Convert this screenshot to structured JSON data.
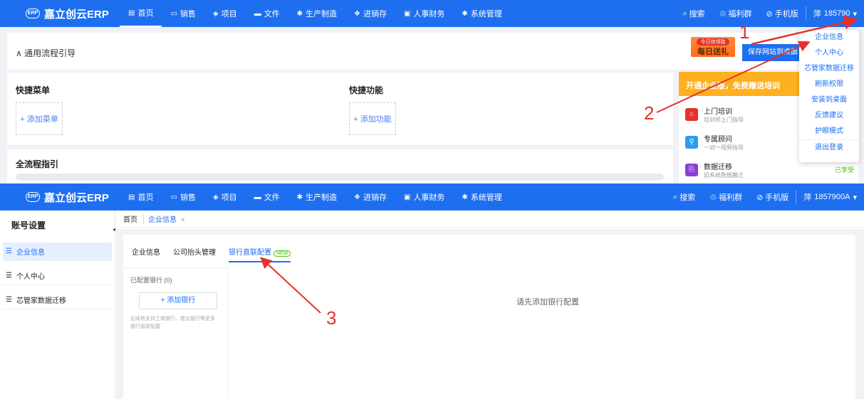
{
  "app": {
    "logo_text": "嘉立创云ERP",
    "logo_mark": "ERP"
  },
  "nav": {
    "items": [
      {
        "icon": "▤",
        "label": "首页"
      },
      {
        "icon": "▭",
        "label": "销售"
      },
      {
        "icon": "◈",
        "label": "项目"
      },
      {
        "icon": "▬",
        "label": "文件"
      },
      {
        "icon": "✱",
        "label": "生产制造"
      },
      {
        "icon": "❖",
        "label": "进销存"
      },
      {
        "icon": "▣",
        "label": "人事财务"
      },
      {
        "icon": "✱",
        "label": "系统管理"
      }
    ]
  },
  "right_tools": {
    "search": "搜索",
    "benefits": "福利群",
    "mobile": "手机版",
    "user_top": "185790",
    "user_bottom": "1857900A",
    "user_icon": "萍"
  },
  "upper": {
    "guide_title": "通用流程引导",
    "quick_menu_title": "快捷菜单",
    "add_menu": "+ 添加菜单",
    "quick_func_title": "快捷功能",
    "add_func": "+ 添加功能",
    "full_guide_title": "全流程指引",
    "promo_tag": "今日待领取",
    "promo_label": "每日送礼",
    "save_button": "保存网站到桌面",
    "service_header": "开通企业版，免费赠送培训",
    "services": [
      {
        "title": "上门培训",
        "sub": "培训师上门指导",
        "color": "#e5312a",
        "icon": "⌂"
      },
      {
        "title": "专属顾问",
        "sub": "一对一视频指导",
        "color": "#2a9bf0",
        "icon": "⚲"
      },
      {
        "title": "数据迁移",
        "sub": "旧系统数据搬迁",
        "color": "#8a3ed6",
        "icon": "⎘",
        "status": "已享受"
      }
    ]
  },
  "dropdown": {
    "items": [
      "企业信息",
      "个人中心",
      "芯管家数据迁移",
      "刷新权限",
      "安装到桌面",
      "反馈建议",
      "护眼模式",
      "退出登录"
    ]
  },
  "sidebar": {
    "title": "账号设置",
    "items": [
      {
        "label": "企业信息"
      },
      {
        "label": "个人中心"
      },
      {
        "label": "芯管家数据迁移"
      }
    ]
  },
  "breadcrumbs": {
    "home": "首页",
    "tab": "企业信息",
    "close": "×"
  },
  "content_tabs": {
    "items": [
      "企业信息",
      "公司抬头管理",
      "银行直联配置"
    ],
    "new_badge": "NEW"
  },
  "bank": {
    "configured": "已配置银行 (0)",
    "add_button": "+ 添加银行",
    "note": "后续将支持工商银行、建设银行等更多银行直联配置",
    "empty": "请先添加银行配置"
  },
  "annotations": {
    "one": "1",
    "two": "2",
    "three": "3"
  }
}
